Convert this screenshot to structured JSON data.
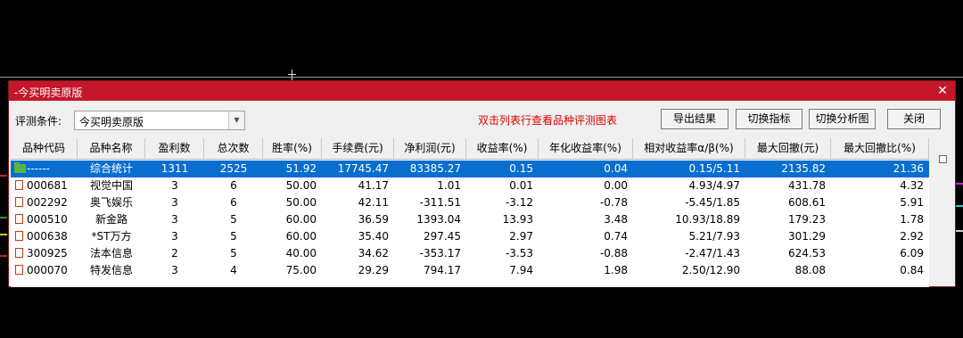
{
  "window": {
    "title": "-今买明卖原版",
    "close": "✕"
  },
  "toolbar": {
    "condition_label": "评测条件:",
    "condition_value": "今买明卖原版",
    "hint": "双击列表行查看品种评测图表",
    "export_label": "导出结果",
    "switch_metric_label": "切换指标",
    "switch_chart_label": "切换分析图",
    "close_label": "关闭"
  },
  "table": {
    "headers": [
      "品种代码",
      "品种名称",
      "盈利数",
      "总次数",
      "胜率(%)",
      "手续费(元)",
      "净利润(元)",
      "收益率(%)",
      "年化收益率(%)",
      "相对收益率α/β(%)",
      "最大回撤(元)",
      "最大回撤比(%)"
    ],
    "rows": [
      [
        "------",
        "综合统计",
        "1311",
        "2525",
        "51.92",
        "17745.47",
        "83385.27",
        "0.15",
        "0.04",
        "0.15/5.11",
        "2135.82",
        "21.36"
      ],
      [
        "000681",
        "视觉中国",
        "3",
        "6",
        "50.00",
        "41.17",
        "1.01",
        "0.01",
        "0.00",
        "4.93/4.97",
        "431.78",
        "4.32"
      ],
      [
        "002292",
        "奥飞娱乐",
        "3",
        "6",
        "50.00",
        "42.11",
        "-311.51",
        "-3.12",
        "-0.78",
        "-5.45/1.85",
        "608.61",
        "5.91"
      ],
      [
        "000510",
        "新金路",
        "3",
        "5",
        "60.00",
        "36.59",
        "1393.04",
        "13.93",
        "3.48",
        "10.93/18.89",
        "179.23",
        "1.78"
      ],
      [
        "000638",
        "*ST万方",
        "3",
        "5",
        "60.00",
        "35.40",
        "297.45",
        "2.97",
        "0.74",
        "5.21/7.93",
        "301.29",
        "2.92"
      ],
      [
        "300925",
        "法本信息",
        "2",
        "5",
        "40.00",
        "34.62",
        "-353.17",
        "-3.53",
        "-0.88",
        "-2.47/1.43",
        "624.53",
        "6.09"
      ],
      [
        "000070",
        "特发信息",
        "3",
        "4",
        "75.00",
        "29.29",
        "794.17",
        "7.94",
        "1.98",
        "2.50/12.90",
        "88.08",
        "0.84"
      ]
    ]
  },
  "colors": {
    "title_bar": "#c4182a",
    "selected_row": "#0a6ecf",
    "hint_text": "#e00000"
  }
}
